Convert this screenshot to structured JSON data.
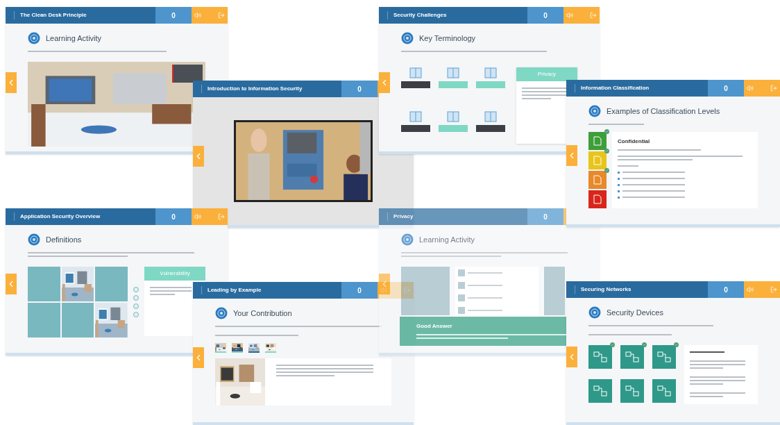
{
  "slides": [
    {
      "kind": "activity",
      "title": "The Clean Desk Principle",
      "score": "0",
      "dimmed": false,
      "heading": "Learning Activity"
    },
    {
      "kind": "terms",
      "title": "Security Challenges",
      "score": "0",
      "dimmed": false,
      "heading": "Key Terminology",
      "terms": [
        {
          "matched": false
        },
        {
          "matched": true
        },
        {
          "matched": true
        },
        {
          "matched": false
        },
        {
          "matched": true
        },
        {
          "matched": false
        }
      ],
      "panel_title": "Privacy"
    },
    {
      "kind": "video",
      "title": "Introduction to Information Security",
      "score": "0",
      "dimmed": false
    },
    {
      "kind": "definitions",
      "title": "Application Security Overview",
      "score": "0",
      "dimmed": false,
      "heading": "Definitions",
      "tiles": [
        {
          "kind": "term"
        },
        {
          "kind": "picture"
        },
        {
          "kind": "term"
        },
        {
          "kind": "term"
        },
        {
          "kind": "term"
        },
        {
          "kind": "picture"
        }
      ],
      "panel_title": "Vulnerability"
    },
    {
      "kind": "contribution",
      "title": "Leading by Example",
      "score": "0",
      "dimmed": false,
      "heading": "Your Contribution",
      "thumbs": [
        {
          "selected": false
        },
        {
          "selected": false
        },
        {
          "selected": true
        },
        {
          "selected": false
        }
      ]
    },
    {
      "kind": "sorting",
      "title": "Privacy",
      "score": "0",
      "dimmed": true,
      "heading": "Learning Activity",
      "feedback_title": "Good Answer"
    },
    {
      "kind": "levels",
      "title": "Information Classification",
      "score": "0",
      "dimmed": false,
      "heading": "Examples of Classification Levels",
      "levels": [
        {
          "color": "#3e9e3a",
          "visited": true
        },
        {
          "color": "#e8c51c",
          "visited": true
        },
        {
          "color": "#e8892a",
          "visited": true
        },
        {
          "color": "#d9261c",
          "visited": false
        }
      ],
      "panel_title": "Confidential"
    },
    {
      "kind": "devices",
      "title": "Securing Networks",
      "score": "0",
      "dimmed": false,
      "heading": "Security Devices",
      "devices": [
        {
          "visited": true
        },
        {
          "visited": true
        },
        {
          "visited": true
        },
        {
          "visited": false
        },
        {
          "visited": false
        },
        {
          "visited": false
        }
      ]
    }
  ]
}
